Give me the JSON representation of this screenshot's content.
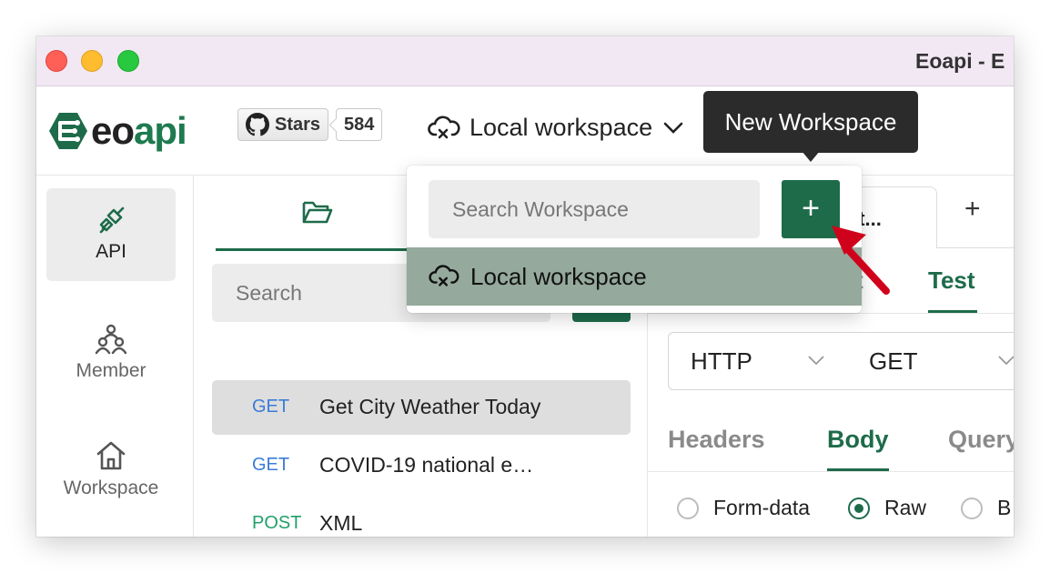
{
  "window": {
    "title": "Eoapi - E"
  },
  "header": {
    "logo_text_a": "eo",
    "logo_text_b": "api",
    "github": {
      "stars_label": "Stars",
      "stars_count": "584"
    },
    "workspace_switch": {
      "label": "Local workspace",
      "icon": "cloud-off-icon"
    }
  },
  "sidebar": {
    "items": [
      {
        "label": "API",
        "icon": "plug-icon",
        "active": true
      },
      {
        "label": "Member",
        "icon": "members-icon"
      },
      {
        "label": "Workspace",
        "icon": "home-icon"
      }
    ]
  },
  "api_pane": {
    "search_placeholder": "Search",
    "items": [
      {
        "method": "GET",
        "name": "Get City Weather Today"
      },
      {
        "method": "GET",
        "name": "COVID-19 national e…"
      },
      {
        "method": "POST",
        "name": "XML"
      }
    ]
  },
  "editor": {
    "tab_title": "at...",
    "subtab_partial": "t",
    "subtab_test": "Test",
    "protocol": "HTTP",
    "method": "GET",
    "body_tabs": [
      "Headers",
      "Body",
      "Query"
    ],
    "radios": [
      "Form-data",
      "Raw",
      "B"
    ]
  },
  "workspace_popup": {
    "search_placeholder": "Search Workspace",
    "add_label": "+",
    "items": [
      {
        "label": "Local workspace"
      }
    ]
  },
  "tooltip": {
    "text": "New Workspace"
  },
  "colors": {
    "brand": "#1e6b4a",
    "selected_row": "#95a99d",
    "tooltip_bg": "#2b2b2b",
    "annotation_arrow": "#d0021b"
  }
}
